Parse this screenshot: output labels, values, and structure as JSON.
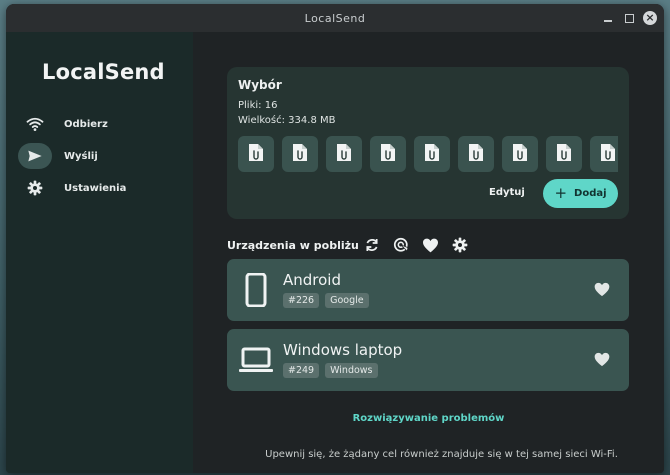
{
  "window": {
    "title": "LocalSend"
  },
  "sidebar": {
    "app_title": "LocalSend",
    "items": [
      {
        "label": "Odbierz",
        "icon": "wifi-icon",
        "active": false
      },
      {
        "label": "Wyślij",
        "icon": "send-icon",
        "active": true
      },
      {
        "label": "Ustawienia",
        "icon": "gear-icon",
        "active": false
      }
    ]
  },
  "selection": {
    "title": "Wybór",
    "files_line": "Pliki: 16",
    "size_line": "Wielkość: 334.8 MB",
    "file_icon": "file-attachment-icon",
    "edit_label": "Edytuj",
    "add_label": "Dodaj"
  },
  "nearby": {
    "title": "Urządzenia w pobliżu",
    "icons": [
      "refresh-icon",
      "scan-target-icon",
      "favorites-heart-icon",
      "settings-gear-icon"
    ]
  },
  "devices": [
    {
      "name": "Android",
      "tags": [
        "#226",
        "Google"
      ],
      "icon": "smartphone-icon"
    },
    {
      "name": "Windows laptop",
      "tags": [
        "#249",
        "Windows"
      ],
      "icon": "laptop-icon"
    }
  ],
  "troubleshoot_label": "Rozwiązywanie problemów",
  "hint": "Upewnij się, że żądany cel również znajduje się w tej samej sieci Wi-Fi.",
  "colors": {
    "accent": "#5fd6c8",
    "sidebar_bg": "#1b2a29",
    "main_bg": "#1f2325",
    "card_bg": "#263532",
    "device_bg": "#3a5551"
  }
}
